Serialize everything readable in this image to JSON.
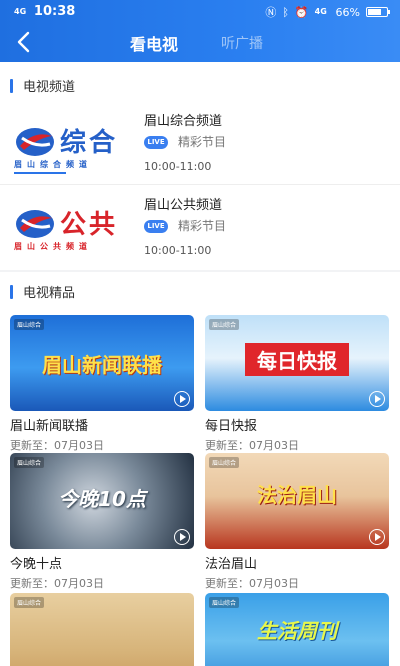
{
  "status_bar": {
    "signal_left": "4G ",
    "time": "10:38",
    "signal_right": "4G ",
    "battery": "66%"
  },
  "header": {
    "tabs": [
      {
        "label": "看电视",
        "active": true
      },
      {
        "label": "听广播",
        "active": false
      }
    ]
  },
  "tv_channels": {
    "section_title": "电视频道",
    "items": [
      {
        "logo_big": "综合",
        "logo_small": "眉山综合频道",
        "logo_color": "#2560c8",
        "name": "眉山综合频道",
        "live": "LIVE",
        "desc": "精彩节目",
        "time": "10:00-11:00"
      },
      {
        "logo_big": "公共",
        "logo_small": "眉山公共频道",
        "logo_color": "#d8242a",
        "name": "眉山公共频道",
        "live": "LIVE",
        "desc": "精彩节目",
        "time": "10:00-11:00"
      }
    ]
  },
  "tv_featured": {
    "section_title": "电视精品",
    "items": [
      {
        "thumb_text": "眉山新闻联播",
        "name": "眉山新闻联播",
        "updated": "更新至：07月03日"
      },
      {
        "thumb_text": "每日快报",
        "name": "每日快报",
        "updated": "更新至：07月03日"
      },
      {
        "thumb_text": "今晚10点",
        "name": "今晚十点",
        "updated": "更新至：07月03日"
      },
      {
        "thumb_text": "法治眉山",
        "name": "法治眉山",
        "updated": "更新至：07月03日"
      },
      {
        "thumb_text": "",
        "name": "",
        "updated": ""
      },
      {
        "thumb_text": "生活周刊",
        "name": "",
        "updated": ""
      }
    ]
  },
  "colors": {
    "accent": "#2a74e8",
    "header_start": "#1f6fe0",
    "header_end": "#3a8cf5"
  }
}
